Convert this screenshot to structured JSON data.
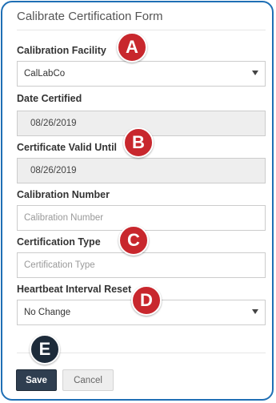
{
  "form": {
    "title": "Calibrate Certification Form",
    "calibration_facility": {
      "label": "Calibration Facility",
      "value": "CalLabCo"
    },
    "date_certified": {
      "label": "Date Certified",
      "value": "08/26/2019"
    },
    "valid_until": {
      "label": "Certificate Valid Until",
      "value": "08/26/2019"
    },
    "calibration_number": {
      "label": "Calibration Number",
      "placeholder": "Calibration Number"
    },
    "certification_type": {
      "label": "Certification Type",
      "placeholder": "Certification Type"
    },
    "heartbeat_reset": {
      "label": "Heartbeat Interval Reset",
      "value": "No Change"
    },
    "save_label": "Save",
    "cancel_label": "Cancel"
  },
  "callouts": [
    "A",
    "B",
    "C",
    "D",
    "E"
  ],
  "colors": {
    "frame_border": "#1f6fb5",
    "callout_red": "#c8272d",
    "callout_dark": "#1d2b3a",
    "save_button": "#2f3e50"
  }
}
